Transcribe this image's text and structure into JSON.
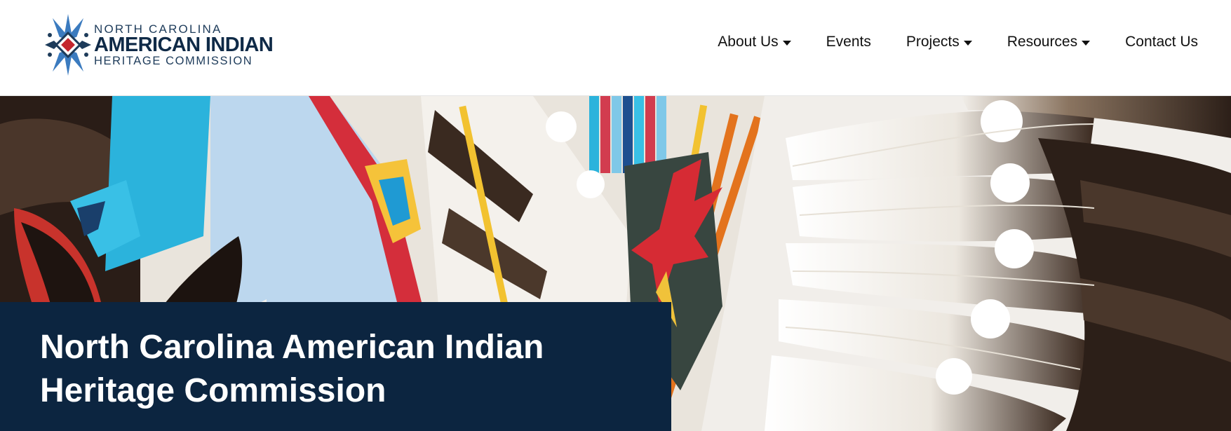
{
  "header": {
    "logo": {
      "line1": "NORTH CAROLINA",
      "line2": "AMERICAN INDIAN",
      "line3": "HERITAGE COMMISSION"
    },
    "nav": [
      {
        "label": "About Us",
        "has_dropdown": true
      },
      {
        "label": "Events",
        "has_dropdown": false
      },
      {
        "label": "Projects",
        "has_dropdown": true
      },
      {
        "label": "Resources",
        "has_dropdown": true
      },
      {
        "label": "Contact Us",
        "has_dropdown": false
      }
    ]
  },
  "hero": {
    "title_line1": "North Carolina American Indian",
    "title_line2": "Heritage Commission"
  },
  "colors": {
    "brand_navy": "#0c2540",
    "logo_blue": "#3b7bbf",
    "logo_red": "#c4262e"
  }
}
